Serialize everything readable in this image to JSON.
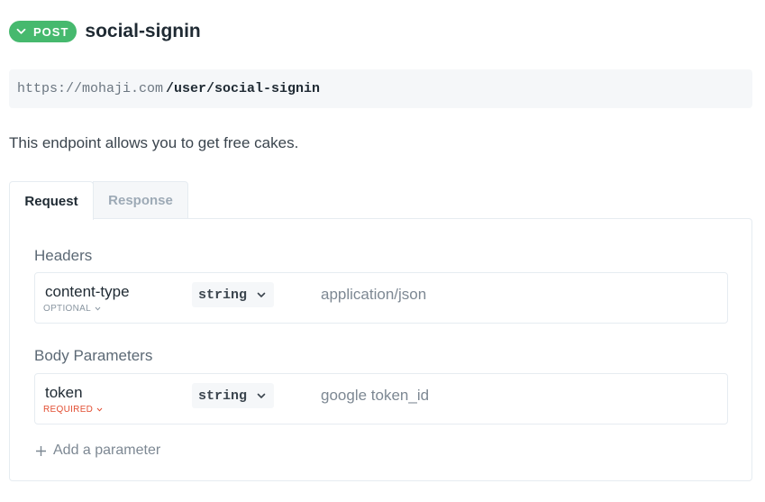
{
  "endpoint": {
    "method": "POST",
    "title": "social-signin",
    "base_url": "https://mohaji.com",
    "path": "/user/social-signin",
    "description": "This endpoint allows you to get free cakes."
  },
  "tabs": [
    {
      "label": "Request",
      "active": true
    },
    {
      "label": "Response",
      "active": false
    }
  ],
  "headers": {
    "title": "Headers",
    "params": [
      {
        "name": "content-type",
        "flag": "OPTIONAL",
        "type": "string",
        "value": "application/json"
      }
    ]
  },
  "body": {
    "title": "Body Parameters",
    "params": [
      {
        "name": "token",
        "flag": "REQUIRED",
        "type": "string",
        "value": "google token_id"
      }
    ]
  },
  "add_parameter_label": "Add a parameter",
  "colors": {
    "method_badge": "#46b96e",
    "required": "#e24e32",
    "optional": "#8a96a1"
  },
  "icons": [
    "chevron-down-icon",
    "plus-icon"
  ]
}
